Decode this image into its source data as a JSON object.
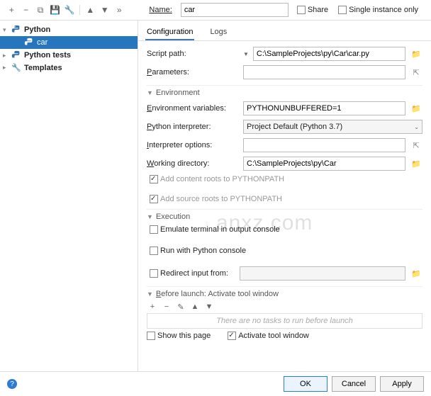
{
  "toolbar": {
    "name_label": "Name:",
    "name_value": "car",
    "share": "Share",
    "single_instance": "Single instance only"
  },
  "tree": {
    "n0": "Python",
    "n1": "car",
    "n2": "Python tests",
    "n3": "Templates"
  },
  "tabs": {
    "config": "Configuration",
    "logs": "Logs"
  },
  "form": {
    "script_path_label": "Script path:",
    "script_path_value": "C:\\SampleProjects\\py\\Car\\car.py",
    "parameters_label": "Parameters:",
    "env_section": "Environment",
    "env_vars_label": "Environment variables:",
    "env_vars_value": "PYTHONUNBUFFERED=1",
    "interpreter_label": "Python interpreter:",
    "interpreter_value": "Project Default (Python 3.7)",
    "interp_opts_label": "Interpreter options:",
    "workdir_label": "Working directory:",
    "workdir_value": "C:\\SampleProjects\\py\\Car",
    "add_content": "Add content roots to PYTHONPATH",
    "add_source": "Add source roots to PYTHONPATH",
    "exec_section": "Execution",
    "emulate": "Emulate terminal in output console",
    "run_console": "Run with Python console",
    "redirect": "Redirect input from:",
    "before_launch": "Before launch: Activate tool window",
    "no_tasks": "There are no tasks to run before launch",
    "show_page": "Show this page",
    "activate_tw": "Activate tool window"
  },
  "buttons": {
    "ok": "OK",
    "cancel": "Cancel",
    "apply": "Apply"
  },
  "watermark": "anxz.com"
}
